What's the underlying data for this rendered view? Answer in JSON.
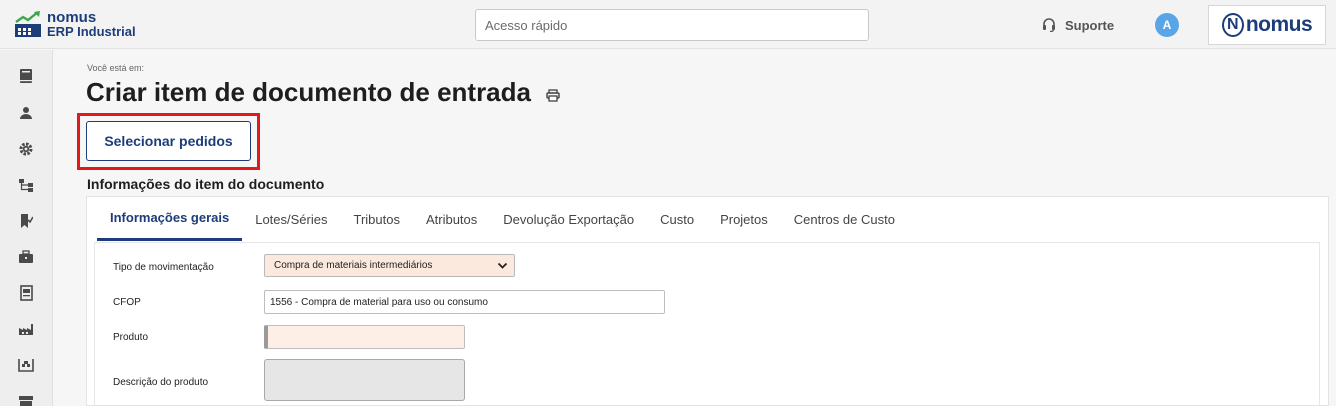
{
  "header": {
    "brand_name": "nomus",
    "brand_sub": "ERP Industrial",
    "quick_access_placeholder": "Acesso rápido",
    "support_label": "Suporte",
    "avatar_initial": "A",
    "logo_text": "nomus",
    "logo_letter": "N"
  },
  "sidebar": {
    "items": [
      "book-icon",
      "user-icon",
      "gear-icon",
      "flow-icon",
      "bookmark-check-icon",
      "briefcase-icon",
      "document-icon",
      "factory-icon",
      "warehouse-icon",
      "archive-icon"
    ]
  },
  "page": {
    "breadcrumb": "Você está em:",
    "title": "Criar item de documento de entrada",
    "select_orders_label": "Selecionar pedidos",
    "section_title": "Informações do item do documento"
  },
  "tabs": [
    {
      "label": "Informações gerais",
      "active": true
    },
    {
      "label": "Lotes/Séries",
      "active": false
    },
    {
      "label": "Tributos",
      "active": false
    },
    {
      "label": "Atributos",
      "active": false
    },
    {
      "label": "Devolução Exportação",
      "active": false
    },
    {
      "label": "Custo",
      "active": false
    },
    {
      "label": "Projetos",
      "active": false
    },
    {
      "label": "Centros de Custo",
      "active": false
    }
  ],
  "form": {
    "movement_type_label": "Tipo de movimentação",
    "movement_type_value": "Compra de materiais intermediários",
    "cfop_label": "CFOP",
    "cfop_value": "1556 - Compra de material para uso ou consumo",
    "product_label": "Produto",
    "product_value": "",
    "description_label": "Descrição do produto"
  },
  "colors": {
    "brand": "#1c3d7a",
    "highlight": "#e01a1a",
    "avatar": "#5aa5e6",
    "required_field": "#fce9dd"
  }
}
